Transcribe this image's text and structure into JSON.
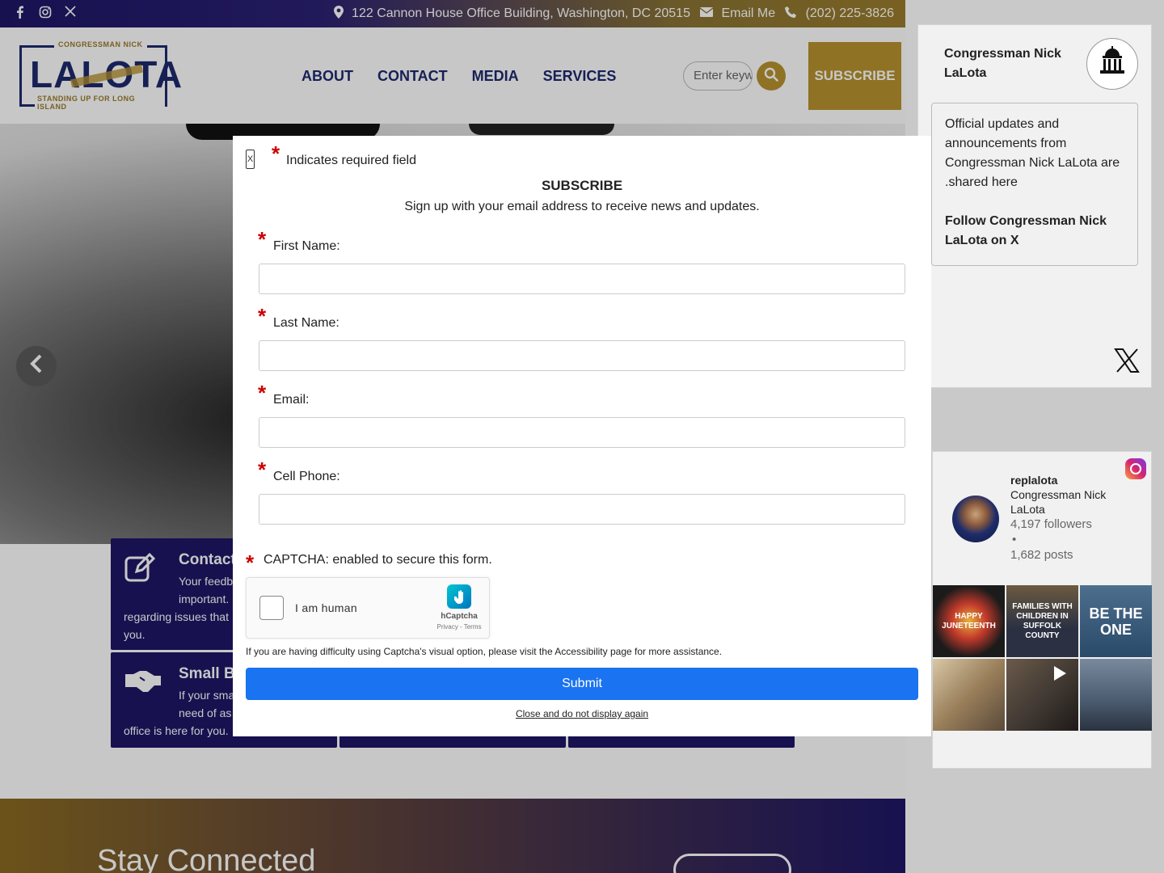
{
  "topbar": {
    "social_icons": [
      "facebook-icon",
      "instagram-icon",
      "x-icon"
    ],
    "address": "122 Cannon House Office Building, Washington, DC 20515",
    "email_label": "Email Me",
    "phone": "(202) 225-3826"
  },
  "logo": {
    "top_text": "CONGRESSMAN NICK",
    "name": "LALOTA",
    "tagline": "STANDING UP FOR LONG ISLAND"
  },
  "nav": {
    "items": [
      "ABOUT",
      "CONTACT",
      "MEDIA",
      "SERVICES"
    ],
    "search_placeholder": "Enter keywords",
    "subscribe_label": "SUBSCRIBE"
  },
  "cards": [
    {
      "title": "Contact",
      "desc_line1": "Your feedb",
      "desc_line2": "important.",
      "desc_line3": "regarding issues that",
      "desc_line4": "you."
    },
    {
      "title": "Small B",
      "desc_line1": "If your sma",
      "desc_line2": "need of as",
      "desc_line3": "office is here for you."
    }
  ],
  "band": {
    "title": "Stay Connected"
  },
  "x_widget": {
    "name": "Congressman Nick LaLota",
    "body": "Official updates and announcements from Congressman Nick LaLota are .shared here",
    "follow": "Follow Congressman Nick LaLota on X"
  },
  "ig_widget": {
    "username": "replalota",
    "display_name": "Congressman Nick LaLota",
    "followers": "4,197 followers",
    "separator": "•",
    "posts": "1,682 posts",
    "tiles": [
      {
        "text": "HAPPY JUNETEENTH",
        "color": "#1b1b1b"
      },
      {
        "text": "FAMILIES WITH CHILDREN IN SUFFOLK COUNTY",
        "color": "#2b3142"
      },
      {
        "text": "BE THE ONE",
        "color": "#2a4a6a"
      },
      {
        "text": "",
        "color": "#9a7f5a"
      },
      {
        "text": "",
        "color": "#3c3530"
      },
      {
        "text": "",
        "color": "#4a5a6e"
      }
    ]
  },
  "modal": {
    "required_note": "Indicates required field",
    "title": "SUBSCRIBE",
    "subtitle": "Sign up with your email address to receive news and updates.",
    "fields": [
      "First Name:",
      "Last Name:",
      "Email:",
      "Cell Phone:"
    ],
    "captcha_label": "CAPTCHA: enabled to secure this form.",
    "captcha_checkbox": "I am human",
    "captcha_brand": "hCaptcha",
    "captcha_terms": "Privacy - Terms",
    "accessibility_note": "If you are having difficulty using Captcha's visual option, please visit the Accessibility page for more assistance.",
    "submit_label": "Submit",
    "close_link": "Close and do not display again",
    "close_x": "X"
  }
}
